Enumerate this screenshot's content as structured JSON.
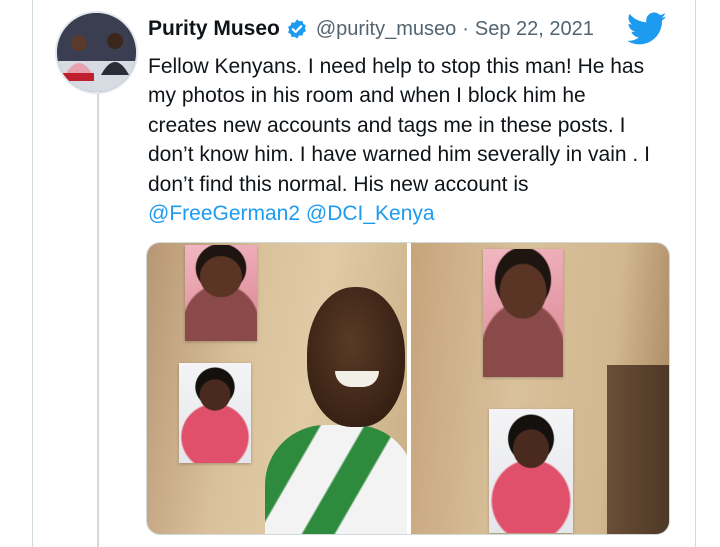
{
  "tweet": {
    "display_name": "Purity Museo",
    "handle": "@purity_museo",
    "separator": "·",
    "date": "Sep 22, 2021",
    "text_lines": [
      "Fellow Kenyans. I need help to stop this man! He has",
      "my photos in his room and when I block him he",
      "creates new accounts and tags me in these posts. I",
      "don’t know him. I have warned him severally in vain . I",
      "don’t find this normal. His new account is"
    ],
    "mentions": [
      "@FreeGerman2",
      "@DCI_Kenya"
    ]
  },
  "icons": {
    "verified": "verified-badge-icon",
    "platform": "twitter-bird-icon"
  },
  "colors": {
    "link": "#1d9bf0",
    "verified": "#1d9bf0",
    "text": "#0f1419",
    "secondary": "#536471"
  }
}
